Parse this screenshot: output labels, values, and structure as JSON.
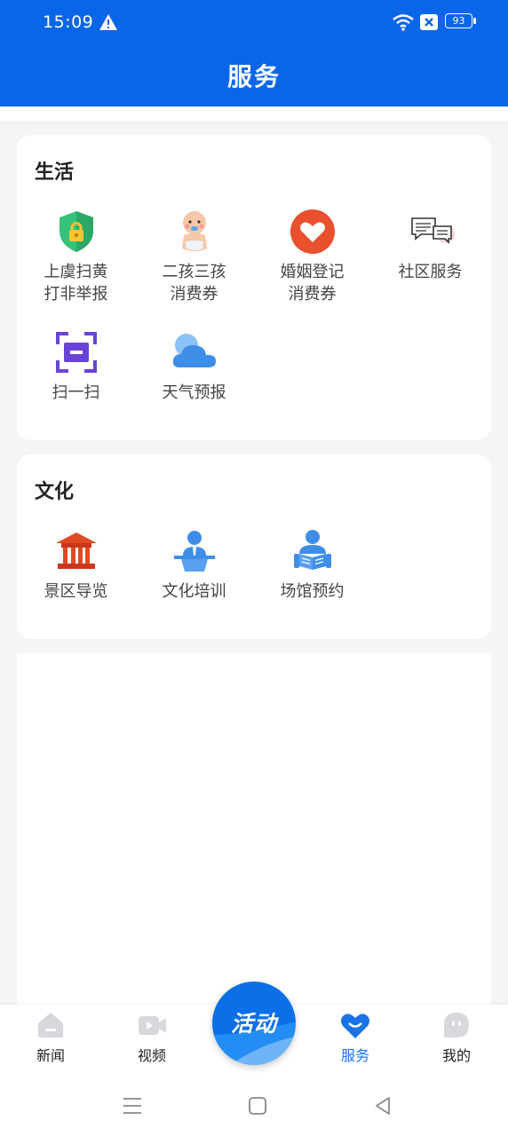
{
  "status": {
    "time": "15:09",
    "battery": "93"
  },
  "header": {
    "title": "服务"
  },
  "sections": [
    {
      "title": "生活",
      "items": [
        {
          "label": "上虞扫黄\n打非举报",
          "icon": "shield-lock-icon"
        },
        {
          "label": "二孩三孩\n消费券",
          "icon": "baby-icon"
        },
        {
          "label": "婚姻登记\n消费券",
          "icon": "heart-icon"
        },
        {
          "label": "社区服务",
          "icon": "chat-bubbles-icon"
        },
        {
          "label": "扫一扫",
          "icon": "scan-icon"
        },
        {
          "label": "天气预报",
          "icon": "cloud-icon"
        }
      ]
    },
    {
      "title": "文化",
      "items": [
        {
          "label": "景区导览",
          "icon": "pavilion-icon"
        },
        {
          "label": "文化培训",
          "icon": "lecturer-icon"
        },
        {
          "label": "场馆预约",
          "icon": "reader-icon"
        }
      ]
    }
  ],
  "tabbar": {
    "tabs": [
      {
        "label": "新闻",
        "icon": "home-icon"
      },
      {
        "label": "视频",
        "icon": "video-icon"
      },
      {
        "label": "服务",
        "icon": "heart-service-icon",
        "active": true
      },
      {
        "label": "我的",
        "icon": "profile-icon"
      }
    ],
    "center": {
      "label": "活动"
    }
  },
  "colors": {
    "primary": "#0a66e8",
    "active_tab": "#1a73e8",
    "background": "#f4f5f7"
  }
}
